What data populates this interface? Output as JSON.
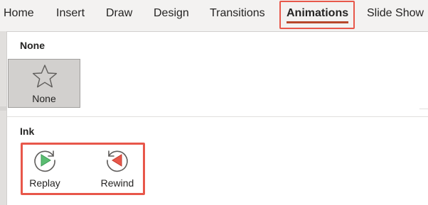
{
  "ribbon": {
    "tabs": [
      {
        "label": "Home"
      },
      {
        "label": "Insert"
      },
      {
        "label": "Draw"
      },
      {
        "label": "Design"
      },
      {
        "label": "Transitions"
      },
      {
        "label": "Animations",
        "active": true
      },
      {
        "label": "Slide Show"
      }
    ]
  },
  "gallery": {
    "sections": [
      {
        "title": "None",
        "items": [
          {
            "label": "None",
            "icon": "star-outline-icon",
            "selected": true
          }
        ]
      },
      {
        "title": "Ink",
        "items": [
          {
            "label": "Replay",
            "icon": "replay-icon"
          },
          {
            "label": "Rewind",
            "icon": "rewind-icon"
          }
        ]
      }
    ]
  },
  "colors": {
    "highlight": "#e8574a",
    "active_underline": "#b7472a",
    "replay_green": "#5bbd72",
    "rewind_red": "#e8574a"
  }
}
